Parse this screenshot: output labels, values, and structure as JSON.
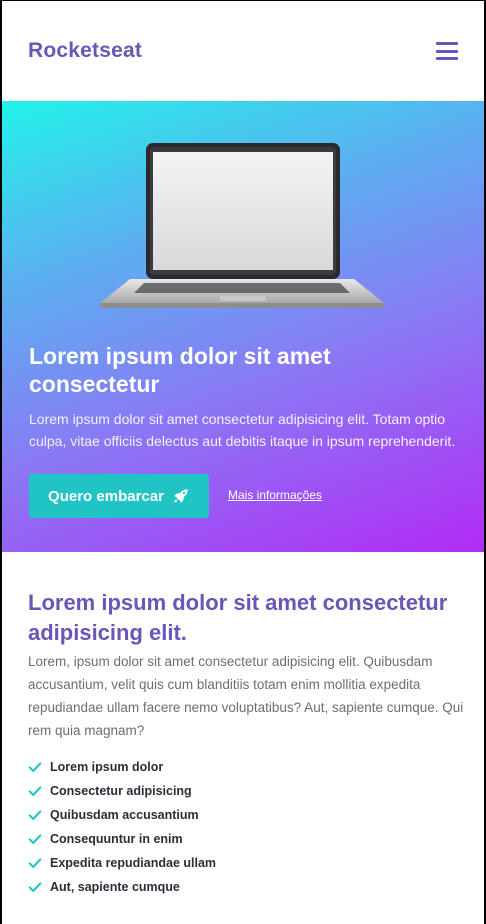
{
  "header": {
    "brand": "Rocketseat",
    "menu_icon": "hamburger-menu-icon"
  },
  "hero": {
    "image_icon": "laptop-illustration",
    "title": "Lorem ipsum dolor sit amet consectetur",
    "text": "Lorem ipsum dolor sit amet consectetur adipisicing elit. Totam optio culpa, vitae officiis delectus aut debitis itaque in ipsum reprehenderit.",
    "cta_label": "Quero embarcar",
    "cta_icon": "rocket-icon",
    "link_label": "Mais informações"
  },
  "section": {
    "title": "Lorem ipsum dolor sit amet consectetur adipisicing elit.",
    "text": "Lorem, ipsum dolor sit amet consectetur adipisicing elit. Quibusdam accusantium, velit quis cum blanditiis totam enim mollitia expedita repudiandae ullam facere nemo voluptatibus? Aut, sapiente cumque. Qui rem quia magnam?",
    "check_icon": "check-icon",
    "items": [
      "Lorem ipsum dolor",
      "Consectetur adipisicing",
      "Quibusdam accusantium",
      "Consequuntur in enim",
      "Expedita repudiandae ullam",
      "Aut, sapiente cumque"
    ]
  },
  "colors": {
    "brand": "#6c55b8",
    "accent": "#21c4c4",
    "gradient_start": "#22f3ea",
    "gradient_end": "#b22bf5"
  }
}
